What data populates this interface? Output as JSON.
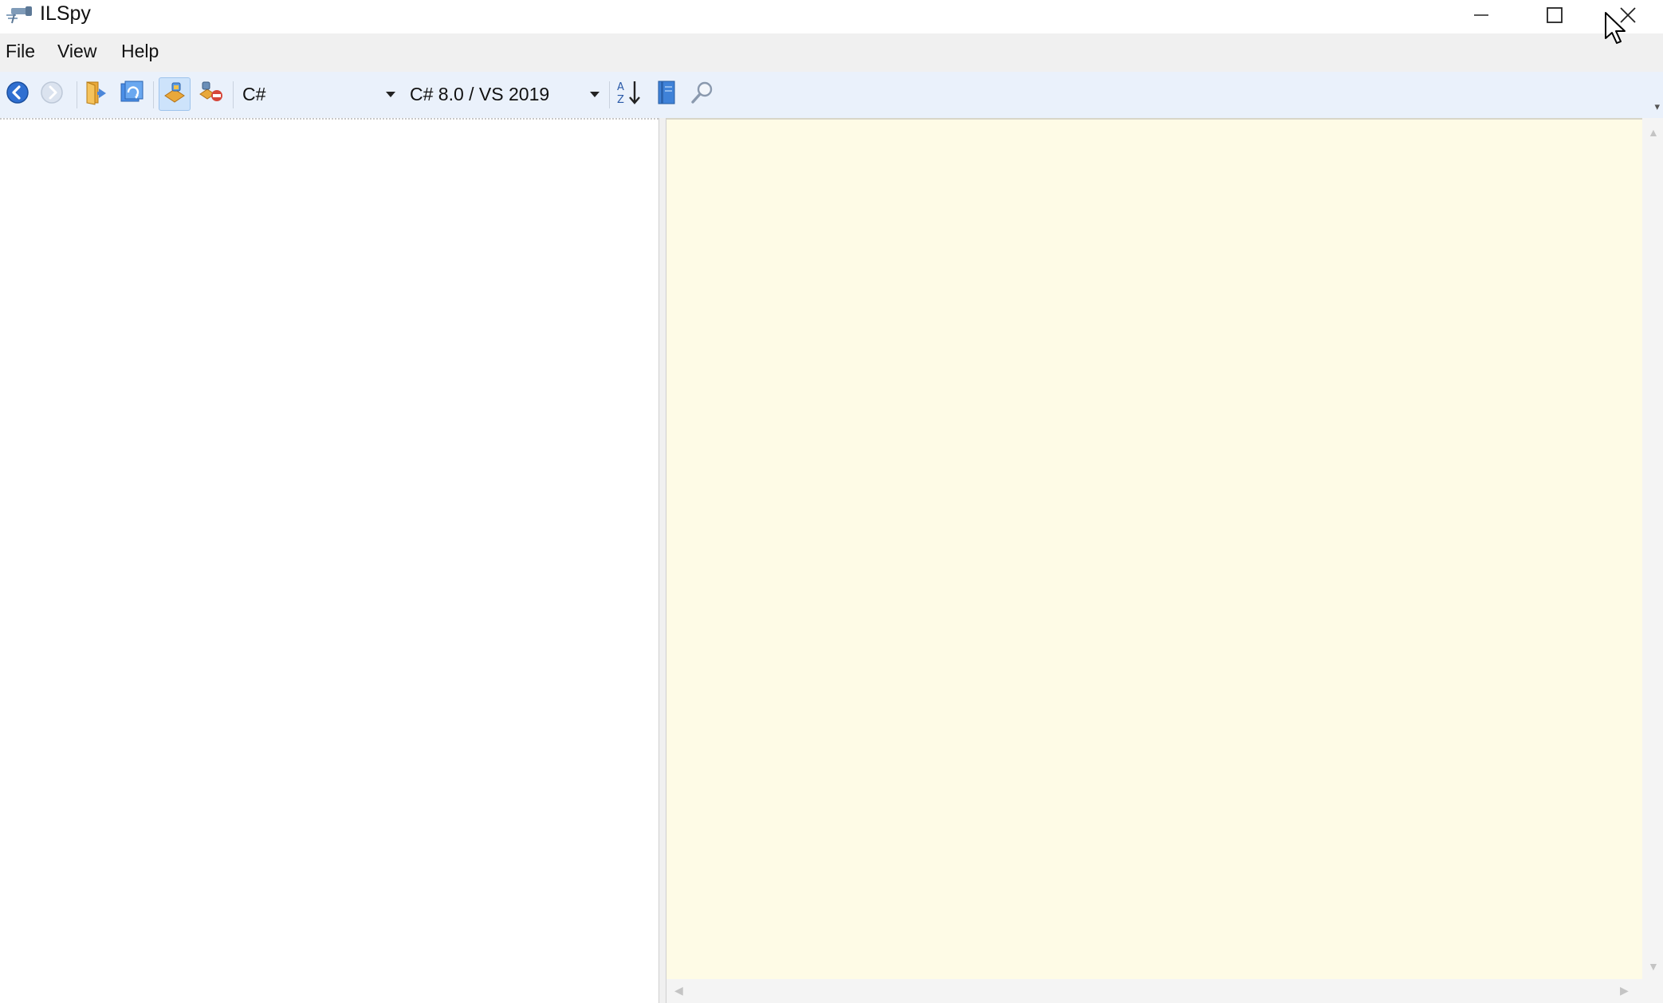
{
  "window": {
    "title": "ILSpy",
    "icon": "ilspy-app-icon",
    "controls": {
      "minimize_icon": "minimize-icon",
      "maximize_icon": "maximize-icon",
      "close_icon": "close-icon"
    }
  },
  "menubar": {
    "items": [
      {
        "label": "File"
      },
      {
        "label": "View"
      },
      {
        "label": "Help"
      }
    ]
  },
  "toolbar": {
    "buttons": [
      {
        "icon": "back-arrow-icon",
        "enabled": true
      },
      {
        "icon": "forward-arrow-icon",
        "enabled": false
      },
      {
        "icon": "open-assembly-icon",
        "enabled": true
      },
      {
        "icon": "reload-icon",
        "enabled": true
      },
      {
        "icon": "show-public-only-icon",
        "enabled": true,
        "checked": true
      },
      {
        "icon": "show-all-members-icon",
        "enabled": true
      },
      {
        "icon": "sort-alphabetically-icon",
        "enabled": true
      },
      {
        "icon": "manage-assembly-list-icon",
        "enabled": true
      },
      {
        "icon": "search-icon",
        "enabled": true
      }
    ],
    "language_select": {
      "value": "C#"
    },
    "version_select": {
      "value": "C# 8.0 / VS 2019"
    }
  },
  "colors": {
    "decompiler_background": "#fefbe6",
    "toolbar_background": "#eaf1fb",
    "menubar_background": "#f0f0f0"
  }
}
